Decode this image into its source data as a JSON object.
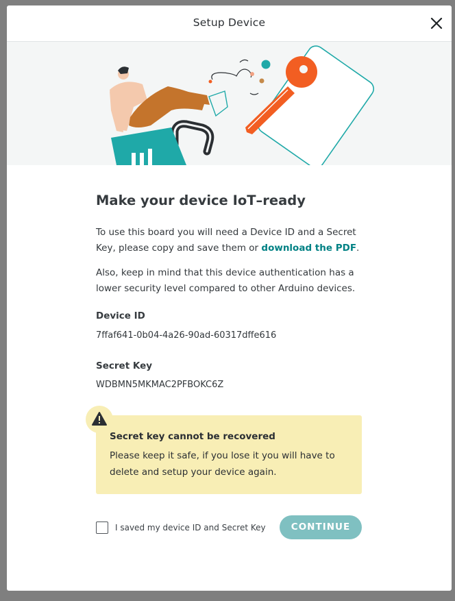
{
  "dialog": {
    "title": "Setup Device",
    "close_icon": "close-icon"
  },
  "hero": {
    "illustration": "person-sitting-on-padlock-with-key-illustration"
  },
  "content": {
    "heading": "Make your device IoT–ready",
    "para1_before_link": "To use this board you will need a Device ID and a Secret Key, please copy and save them or ",
    "para1_link": "download the PDF",
    "para1_after_link": ".",
    "para2": "Also, keep in mind that this device authentication has a lower security level compared to other Arduino devices.",
    "device_id_label": "Device ID",
    "device_id_value": "7ffaf641-0b04-4a26-90ad-60317dffe616",
    "secret_key_label": "Secret Key",
    "secret_key_value": "WDBMN5MKMAC2PFBOKC6Z"
  },
  "warning": {
    "icon": "warning-icon",
    "title": "Secret key cannot be recovered",
    "text": "Please keep it safe, if you lose it you will have to delete and setup your device again."
  },
  "footer": {
    "checkbox_label": "I saved my device ID and Secret Key",
    "checkbox_checked": false,
    "continue_label": "CONTINUE"
  },
  "colors": {
    "accent": "#008184",
    "continue_disabled": "#7fc0c1",
    "warning_bg": "#f8eeb5",
    "key_orange": "#f25e22",
    "lock_teal": "#1fa9a8"
  }
}
